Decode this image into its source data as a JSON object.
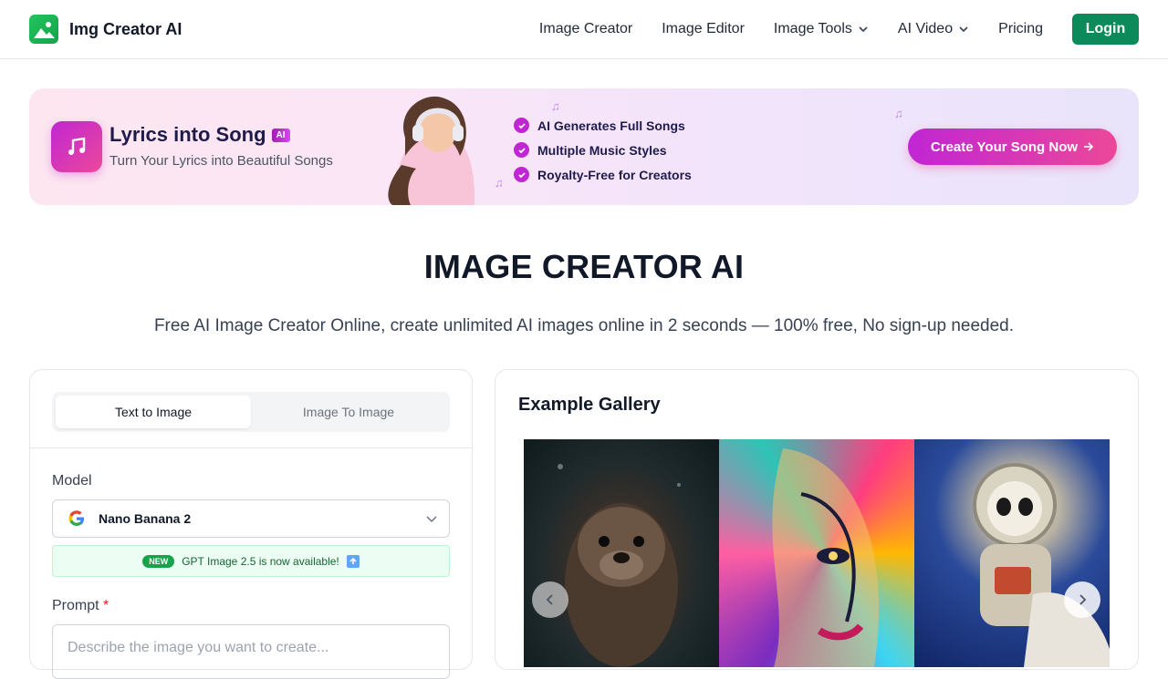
{
  "header": {
    "brand": "Img Creator AI",
    "nav": [
      {
        "label": "Image Creator",
        "dropdown": false
      },
      {
        "label": "Image Editor",
        "dropdown": false
      },
      {
        "label": "Image Tools",
        "dropdown": true
      },
      {
        "label": "AI Video",
        "dropdown": true
      },
      {
        "label": "Pricing",
        "dropdown": false
      }
    ],
    "login_label": "Login",
    "brand_color": "#16a34a"
  },
  "banner": {
    "title": "Lyrics into Song",
    "badge": "AI",
    "subtitle": "Turn Your Lyrics into Beautiful Songs",
    "features": [
      "AI Generates Full Songs",
      "Multiple Music Styles",
      "Royalty-Free for Creators"
    ],
    "cta": "Create Your Song Now",
    "accent": "#c026d3"
  },
  "hero": {
    "title": "IMAGE CREATOR AI",
    "subtitle": "Free AI Image Creator Online, create unlimited AI images online in 2 seconds — 100% free, No sign-up needed."
  },
  "form": {
    "tabs": [
      "Text to Image",
      "Image To Image"
    ],
    "active_tab": "Text to Image",
    "model_label": "Model",
    "model_value": "Nano Banana 2",
    "notice_badge": "NEW",
    "notice_text": "GPT Image 2.5 is now available!",
    "prompt_label": "Prompt",
    "prompt_required_mark": "*",
    "prompt_placeholder": "Describe the image you want to create..."
  },
  "gallery": {
    "title": "Example Gallery"
  }
}
